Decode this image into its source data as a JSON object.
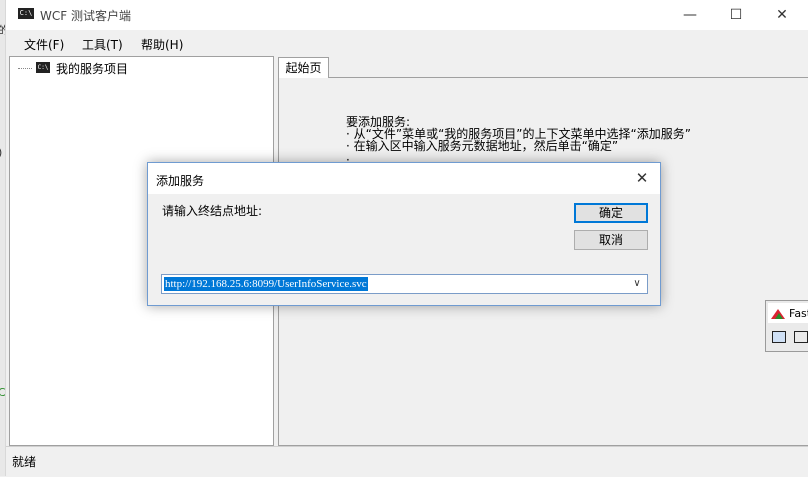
{
  "background": {
    "fragments": [
      "的",
      ")",
      "C"
    ]
  },
  "window": {
    "title": "WCF 测试客户端",
    "icon_text": "C:\\",
    "controls": {
      "minimize": "—",
      "maximize": "☐",
      "close": "✕"
    }
  },
  "menu": {
    "items": [
      {
        "label": "文件(F)"
      },
      {
        "label": "工具(T)"
      },
      {
        "label": "帮助(H)"
      }
    ]
  },
  "tree": {
    "root": {
      "icon_text": "C:\\",
      "label": "我的服务项目"
    }
  },
  "tab": {
    "label": "起始页"
  },
  "instructions": {
    "heading": "要添加服务:",
    "lines": [
      "· 从“文件”菜单或“我的服务项目”的上下文菜单中选择“添加服务”",
      "· 在输入区中输入服务元数据地址，然后单击“确定”",
      "· ......"
    ]
  },
  "status": {
    "text": "就绪"
  },
  "dialog": {
    "title": "添加服务",
    "close": "✕",
    "prompt": "请输入终结点地址:",
    "ok_label": "确定",
    "cancel_label": "取消",
    "address_value": "http://192.168.25.6:8099/UserInfoService.svc",
    "dropdown_icon": "chevron-down-icon"
  },
  "other_app": {
    "name": "Fast"
  },
  "colors": {
    "accent": "#0078d7",
    "dialog_border": "#6f9bd1"
  }
}
